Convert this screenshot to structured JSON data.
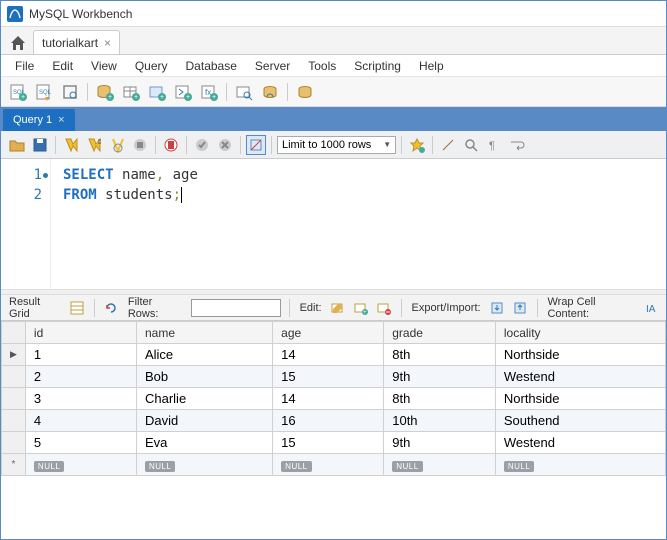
{
  "window": {
    "title": "MySQL Workbench"
  },
  "connection_tab": {
    "label": "tutorialkart"
  },
  "menubar": [
    "File",
    "Edit",
    "View",
    "Query",
    "Database",
    "Server",
    "Tools",
    "Scripting",
    "Help"
  ],
  "query_tab": {
    "label": "Query 1"
  },
  "limit_combo": {
    "label": "Limit to 1000 rows"
  },
  "editor": {
    "line1_kw": "SELECT",
    "line1_id1": "name",
    "line1_comma": ",",
    "line1_id2": "age",
    "line2_kw": "FROM",
    "line2_id": "students",
    "line2_semi": ";",
    "ln1": "1",
    "ln2": "2"
  },
  "result_toolbar": {
    "result_grid": "Result Grid",
    "filter_label": "Filter Rows:",
    "filter_value": "",
    "edit_label": "Edit:",
    "export_label": "Export/Import:",
    "wrap_label": "Wrap Cell Content:"
  },
  "grid": {
    "columns": [
      "id",
      "name",
      "age",
      "grade",
      "locality"
    ],
    "rows": [
      {
        "id": "1",
        "name": "Alice",
        "age": "14",
        "grade": "8th",
        "locality": "Northside"
      },
      {
        "id": "2",
        "name": "Bob",
        "age": "15",
        "grade": "9th",
        "locality": "Westend"
      },
      {
        "id": "3",
        "name": "Charlie",
        "age": "14",
        "grade": "8th",
        "locality": "Northside"
      },
      {
        "id": "4",
        "name": "David",
        "age": "16",
        "grade": "10th",
        "locality": "Southend"
      },
      {
        "id": "5",
        "name": "Eva",
        "age": "15",
        "grade": "9th",
        "locality": "Westend"
      }
    ],
    "null_label": "NULL"
  }
}
